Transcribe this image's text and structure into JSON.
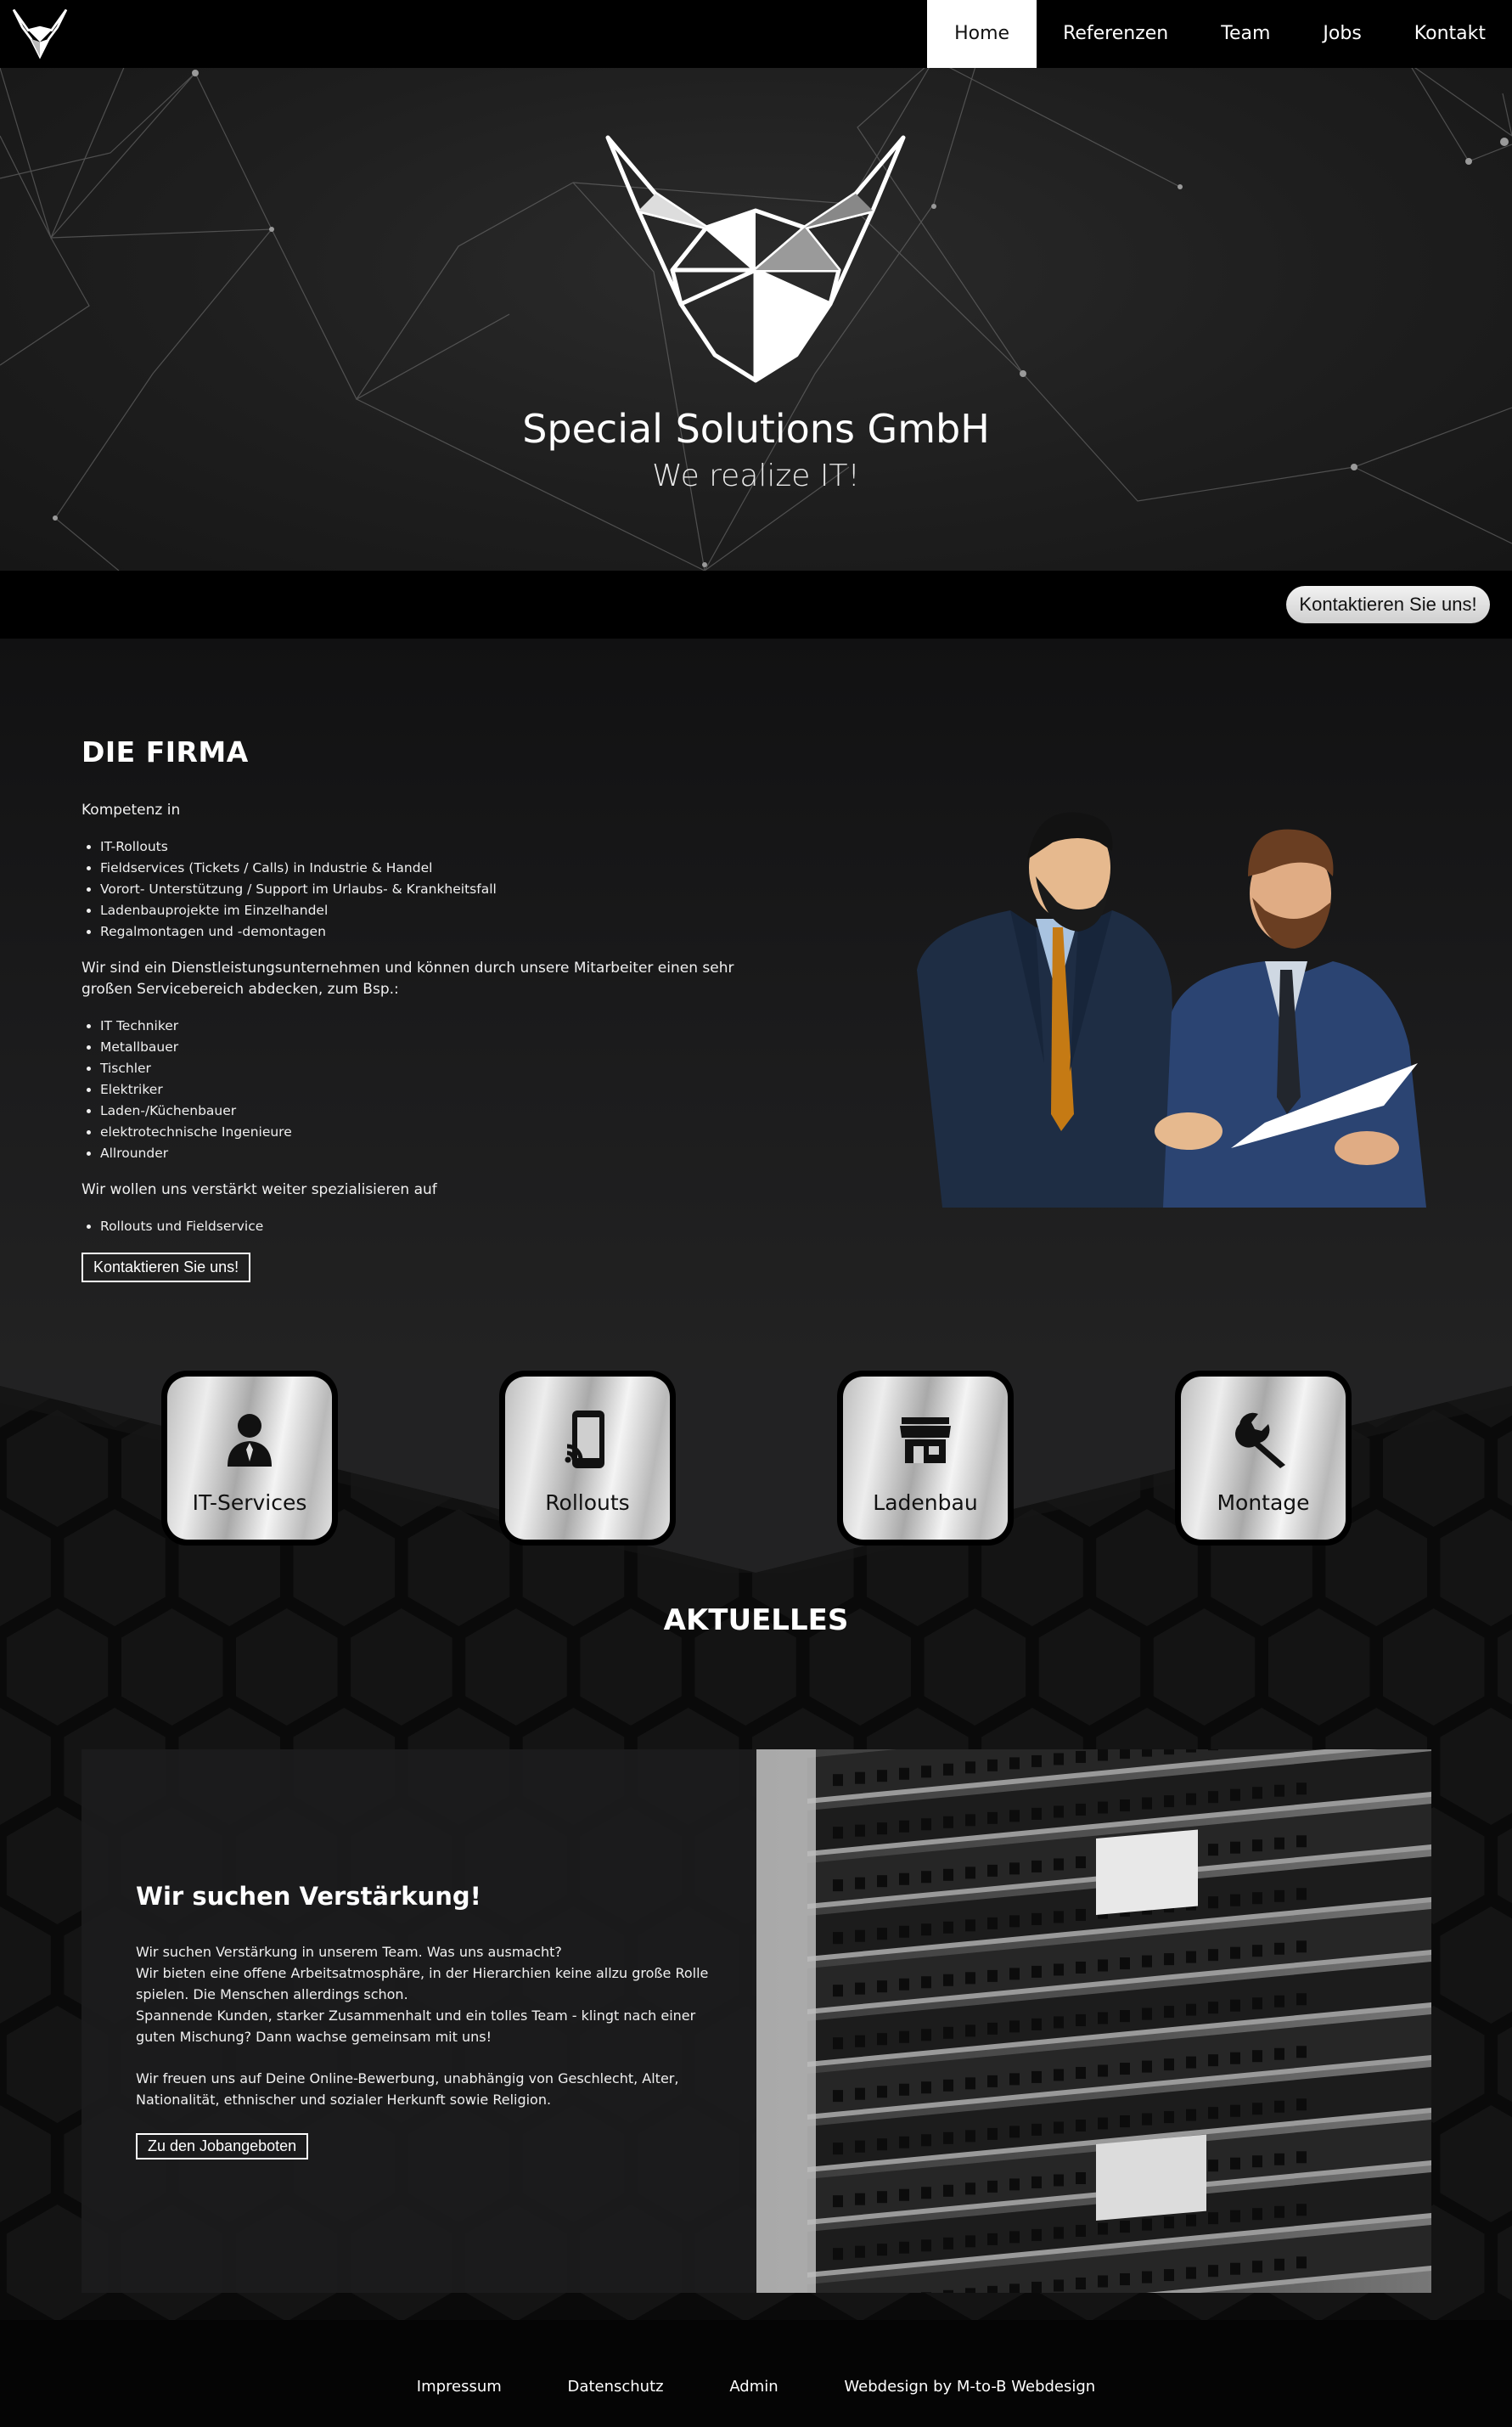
{
  "nav": {
    "items": [
      {
        "label": "Home",
        "active": true
      },
      {
        "label": "Referenzen",
        "active": false
      },
      {
        "label": "Team",
        "active": false
      },
      {
        "label": "Jobs",
        "active": false
      },
      {
        "label": "Kontakt",
        "active": false
      }
    ]
  },
  "hero": {
    "title": "Special Solutions GmbH",
    "subtitle": "We realize IT!"
  },
  "strip": {
    "contact_label": "Kontaktieren Sie uns!"
  },
  "firma": {
    "heading": "DIE FIRMA",
    "intro": "Kompetenz in",
    "competences": [
      "IT-Rollouts",
      "Fieldservices (Tickets / Calls) in Industrie & Handel",
      "Vorort- Unterstützung / Support im Urlaubs- & Krankheitsfall",
      "Ladenbauprojekte im Einzelhandel",
      "Regalmontagen und -demontagen"
    ],
    "service_text": "Wir sind ein Dienstleistungsunternehmen und können durch unsere Mitarbeiter einen sehr großen Servicebereich abdecken, zum Bsp.:",
    "staff": [
      "IT Techniker",
      "Metallbauer",
      "Tischler",
      "Elektriker",
      "Laden-/Küchenbauer",
      "elektrotechnische Ingenieure",
      "Allrounder"
    ],
    "special_text": "Wir wollen uns verstärkt weiter spezialisieren auf",
    "specials": [
      "Rollouts und Fieldservice"
    ],
    "contact_label": "Kontaktieren Sie uns!"
  },
  "services": [
    {
      "label": "IT-Services",
      "icon": "user-tie-icon"
    },
    {
      "label": "Rollouts",
      "icon": "mobile-cast-icon"
    },
    {
      "label": "Ladenbau",
      "icon": "store-icon"
    },
    {
      "label": "Montage",
      "icon": "wrench-icon"
    }
  ],
  "aktuelles": {
    "heading": "AKTUELLES",
    "card_title": "Wir suchen Verstärkung!",
    "line1": "Wir suchen Verstärkung in unserem Team. Was uns ausmacht?",
    "line2": "Wir bieten eine offene Arbeitsatmosphäre, in der Hierarchien keine allzu große Rolle spielen. Die Menschen allerdings schon.",
    "line3": "Spannende Kunden, starker Zusammenhalt und ein tolles Team - klingt nach einer guten Mischung? Dann wachse gemeinsam mit uns!",
    "line4": "Wir freuen uns auf Deine Online-Bewerbung, unabhängig von Geschlecht, Alter, Nationalität, ethnischer und sozialer Herkunft sowie Religion.",
    "button_label": "Zu den Jobangeboten"
  },
  "footer": {
    "links": [
      "Impressum",
      "Datenschutz",
      "Admin",
      "Webdesign by M-to-B Webdesign"
    ]
  }
}
